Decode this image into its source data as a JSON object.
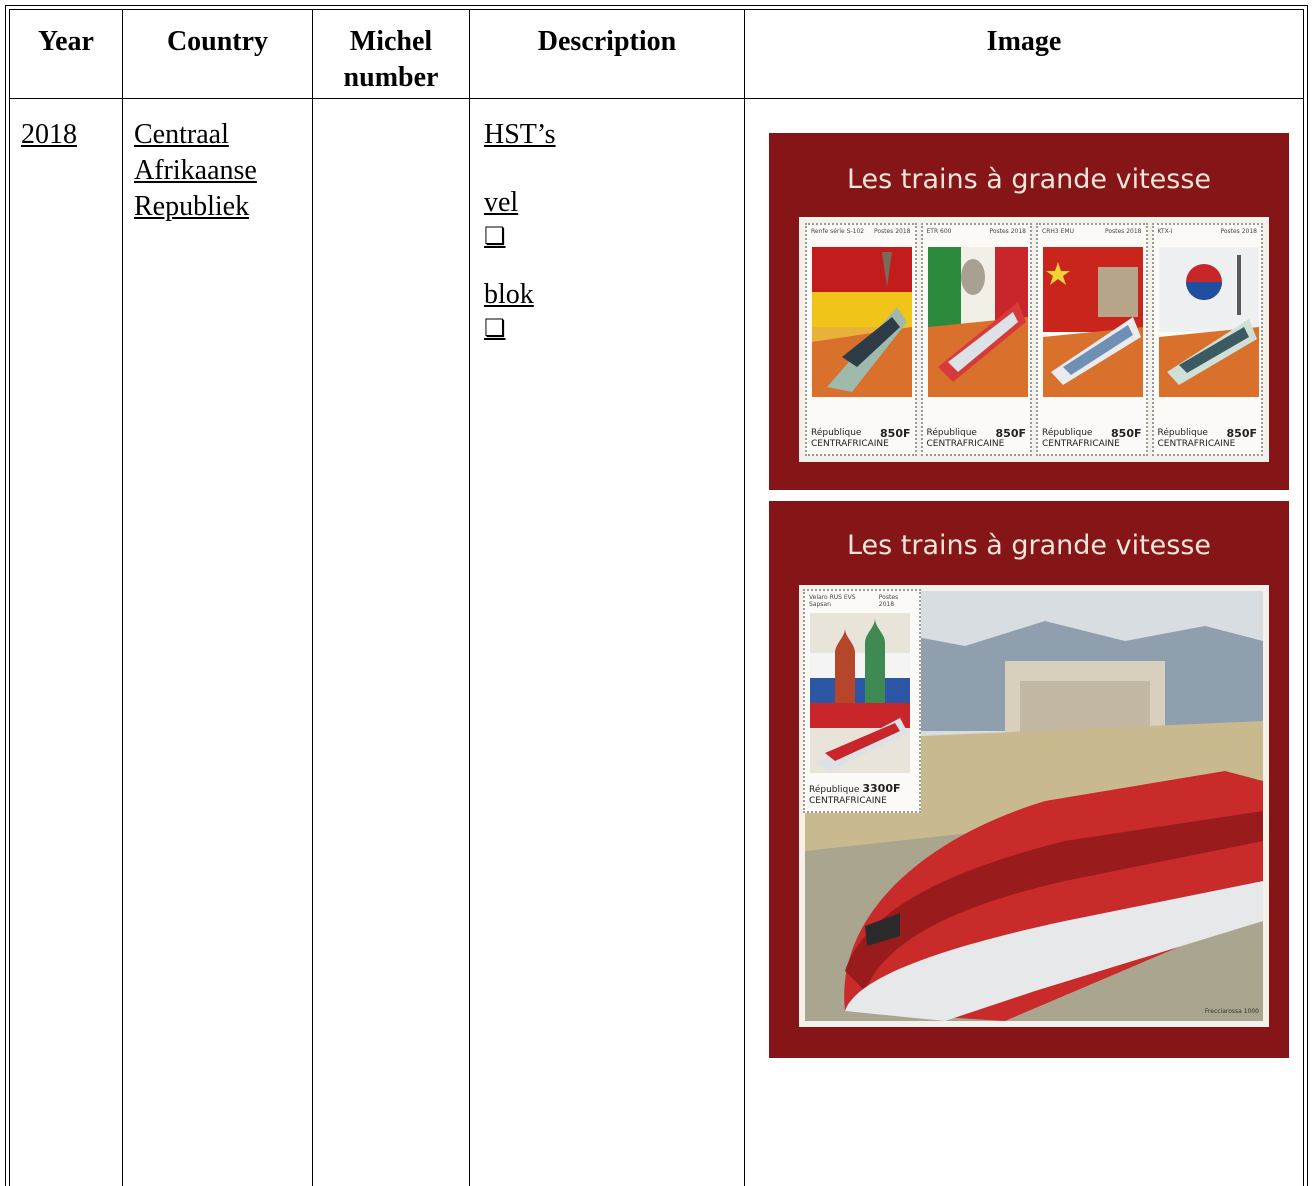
{
  "table": {
    "headers": {
      "year": "Year",
      "country": "Country",
      "michel": "Michel number",
      "description": "Description",
      "image": "Image"
    },
    "row": {
      "year": "2018",
      "country": "Centraal Afrikaanse Republiek",
      "michel": "",
      "description": {
        "title": "HST’s",
        "items": [
          {
            "label": "vel",
            "checkbox": "❏"
          },
          {
            "label": "blok",
            "checkbox": "❏"
          }
        ]
      }
    }
  },
  "sheets": {
    "sheet_one": {
      "title": "Les trains à grande vitesse",
      "stamps": [
        {
          "name": "Renfe série S-102",
          "postes": "Postes 2018",
          "country_line1": "République",
          "country_line2": "CENTRAFRICAINE",
          "value": "850F"
        },
        {
          "name": "ETR 600",
          "postes": "Postes 2018",
          "country_line1": "République",
          "country_line2": "CENTRAFRICAINE",
          "value": "850F"
        },
        {
          "name": "CRH3 EMU",
          "postes": "Postes 2018",
          "country_line1": "République",
          "country_line2": "CENTRAFRICAINE",
          "value": "850F"
        },
        {
          "name": "KTX-I",
          "postes": "Postes 2018",
          "country_line1": "République",
          "country_line2": "CENTRAFRICAINE",
          "value": "850F"
        }
      ]
    },
    "sheet_two": {
      "title": "Les trains à grande vitesse",
      "stamp": {
        "name": "Velaro RUS EVS Sapsan",
        "postes": "Postes 2018",
        "country_line1": "République",
        "country_line2": "CENTRAFRICAINE",
        "value": "3300F"
      },
      "credit": "Frecciarossa 1000"
    }
  },
  "colors": {
    "sheet_background": "#861517",
    "title_text": "#f3e6d8"
  }
}
